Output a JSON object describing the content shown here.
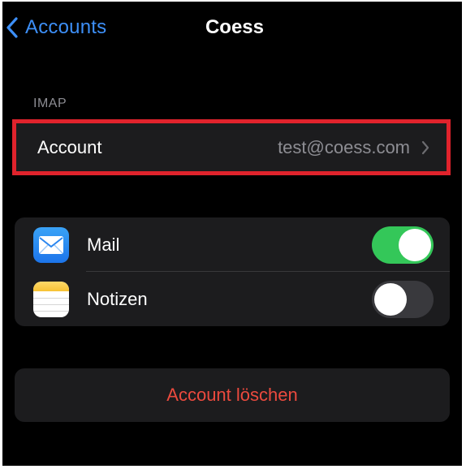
{
  "nav": {
    "back_label": "Accounts",
    "title": "Coess"
  },
  "imap_section": {
    "header": "IMAP",
    "account_row": {
      "label": "Account",
      "value": "test@coess.com"
    },
    "highlight_color": "#e0232c"
  },
  "toggles": [
    {
      "label": "Mail",
      "icon": "mail-envelope-icon",
      "enabled": true
    },
    {
      "label": "Notizen",
      "icon": "notes-icon",
      "enabled": false
    }
  ],
  "delete_button": {
    "label": "Account löschen"
  },
  "colors": {
    "background": "#000000",
    "cell": "#1c1c1e",
    "accent_blue": "#3d8ff7",
    "toggle_on": "#34c759",
    "destructive": "#eb4a3e",
    "secondary_text": "#8d8d93"
  }
}
